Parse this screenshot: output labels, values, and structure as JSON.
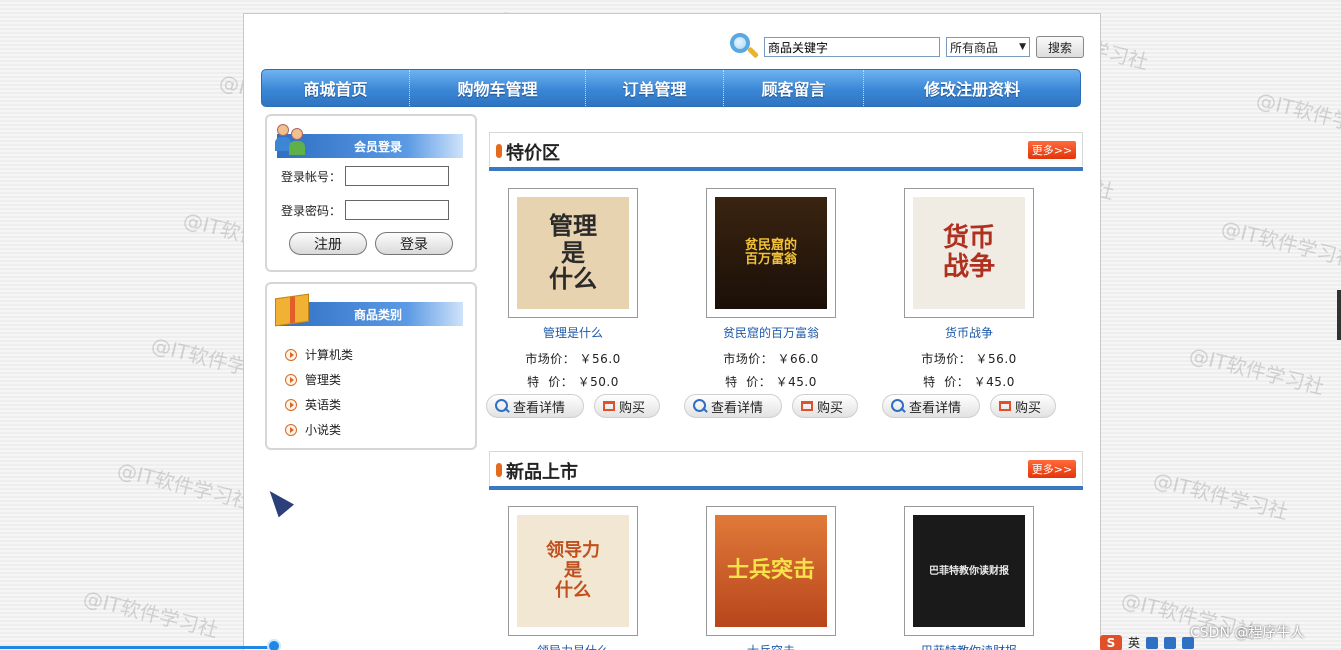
{
  "search": {
    "placeholder": "商品关键字",
    "category_selected": "所有商品",
    "button_label": "搜索"
  },
  "nav": {
    "items": [
      {
        "label": "商城首页"
      },
      {
        "label": "购物车管理"
      },
      {
        "label": "订单管理"
      },
      {
        "label": "顾客留言"
      },
      {
        "label": "修改注册资料"
      }
    ]
  },
  "login": {
    "title": "会员登录",
    "account_label": "登录帐号：",
    "password_label": "登录密码：",
    "register_label": "注册",
    "login_label": "登录"
  },
  "categories": {
    "title": "商品类别",
    "items": [
      "计算机类",
      "管理类",
      "英语类",
      "小说类"
    ]
  },
  "sections": [
    {
      "title": "特价区",
      "more_label": "更多>>",
      "products": [
        {
          "name": "管理是什么",
          "cover_text": "管理\n是\n什么",
          "market_label": "市场价：",
          "market_price": "￥56.0",
          "special_label": "特  价：",
          "special_price": "￥50.0",
          "cover_color": "#e8d3b0",
          "cover_ink": "#2a2a2a"
        },
        {
          "name": "贫民窟的百万富翁",
          "cover_text": "贫民窟的\n百万富翁",
          "market_label": "市场价：",
          "market_price": "￥66.0",
          "special_label": "特  价：",
          "special_price": "￥45.0",
          "cover_color": "#2a1a10",
          "cover_ink": "#f2c236"
        },
        {
          "name": "货币战争",
          "cover_text": "货币\n战争",
          "market_label": "市场价：",
          "market_price": "￥56.0",
          "special_label": "特  价：",
          "special_price": "￥45.0",
          "cover_color": "#f1ece3",
          "cover_ink": "#b03020"
        }
      ],
      "detail_label": "查看详情",
      "buy_label": "购买"
    },
    {
      "title": "新品上市",
      "more_label": "更多>>",
      "products": [
        {
          "name": "领导力是什么",
          "cover_text": "领导力\n是\n什么",
          "cover_color": "#f2e7d2",
          "cover_ink": "#c0501e"
        },
        {
          "name": "士兵突击",
          "cover_text": "士兵突击",
          "cover_color": "#d4622a",
          "cover_ink": "#f6e34a"
        },
        {
          "name": "巴菲特教你读财报",
          "cover_text": "巴菲特教你读财报",
          "cover_color": "#1a1a1a",
          "cover_ink": "#e8e8e8"
        }
      ]
    }
  ],
  "footer": {
    "credit": "CSDN @程序牛人",
    "ime_lang": "英"
  },
  "watermark_text": "@IT软件学习社",
  "colors": {
    "nav_blue": "#3a87d6",
    "accent_orange": "#e3340b",
    "link_blue": "#1e5aa8"
  }
}
